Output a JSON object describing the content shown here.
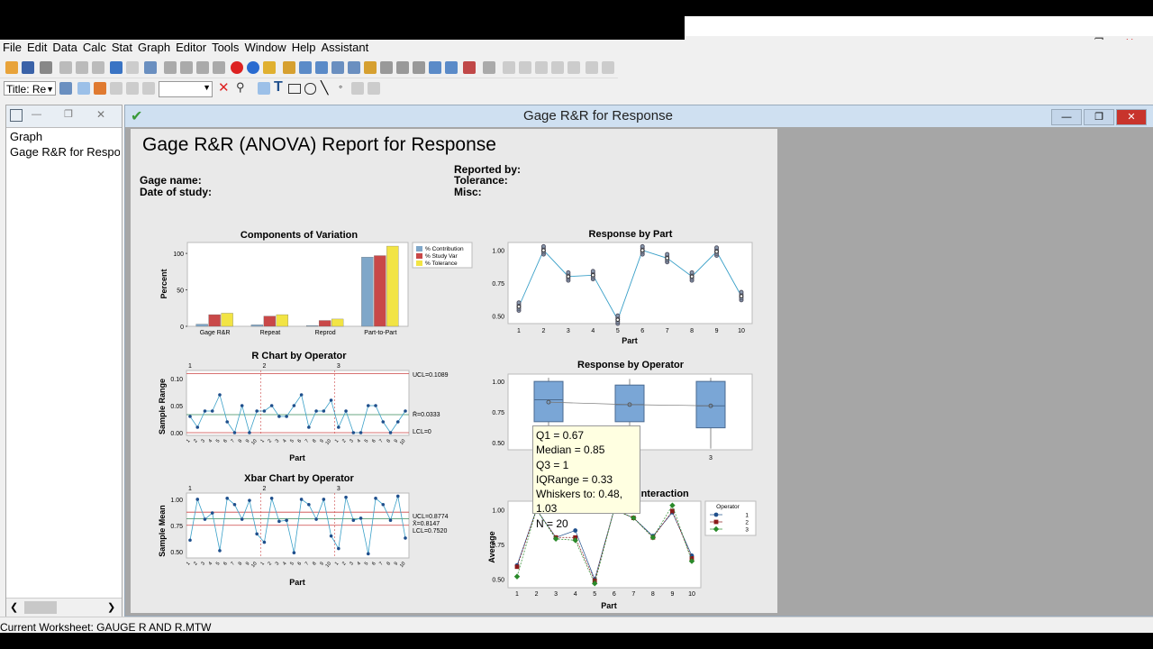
{
  "menu": [
    "File",
    "Edit",
    "Data",
    "Calc",
    "Stat",
    "Graph",
    "Editor",
    "Tools",
    "Window",
    "Help",
    "Assistant"
  ],
  "toolbar2": {
    "title_dropdown": "Title: Re"
  },
  "left_panel": {
    "items": [
      "Graph",
      "Gage R&R for Respon"
    ]
  },
  "doc_window": {
    "title": "Gage R&R for Response"
  },
  "report": {
    "title": "Gage R&R (ANOVA) Report for Response",
    "gage_name": "Gage name:",
    "date_of_study": "Date of study:",
    "reported_by": "Reported by:",
    "tolerance": "Tolerance:",
    "misc": "Misc:"
  },
  "tooltip": [
    "Q1 = 0.67",
    "Median = 0.85",
    "Q3 = 1",
    "IQRange = 0.33",
    "Whiskers to: 0.48, 1.03",
    "N = 20"
  ],
  "status": "Current Worksheet: GAUGE R AND R.MTW",
  "colors": {
    "contribution": "#7fa7c9",
    "studyvar": "#c94848",
    "tolerance": "#f2e444",
    "line": "#3aa0c8",
    "point": "#1f4f8c",
    "box": "#7aa6d6"
  },
  "chart_data": [
    {
      "type": "bar",
      "title": "Components of Variation",
      "ylabel": "Percent",
      "categories": [
        "Gage R&R",
        "Repeat",
        "Reprod",
        "Part-to-Part"
      ],
      "series": [
        {
          "name": "% Contribution",
          "values": [
            3,
            2,
            1,
            95
          ]
        },
        {
          "name": "% Study Var",
          "values": [
            16,
            14,
            8,
            97
          ]
        },
        {
          "name": "% Tolerance",
          "values": [
            18,
            16,
            10,
            110
          ]
        }
      ],
      "yticks": [
        0,
        50,
        100
      ],
      "ylim": [
        0,
        115
      ]
    },
    {
      "type": "scatter",
      "title": "Response by Part",
      "xlabel": "Part",
      "x": [
        1,
        2,
        3,
        4,
        5,
        6,
        7,
        8,
        9,
        10
      ],
      "means": [
        0.57,
        1.0,
        0.8,
        0.81,
        0.47,
        1.0,
        0.94,
        0.8,
        0.99,
        0.65
      ],
      "yticks": [
        0.5,
        0.75,
        1.0
      ],
      "ylim": [
        0.44,
        1.06
      ]
    },
    {
      "type": "line",
      "title": "R Chart by Operator",
      "xlabel": "Part",
      "ylabel": "Sample Range",
      "operators": [
        "1",
        "2",
        "3"
      ],
      "values": [
        0.03,
        0.01,
        0.04,
        0.04,
        0.07,
        0.02,
        0.0,
        0.05,
        0.0,
        0.04,
        0.04,
        0.05,
        0.03,
        0.03,
        0.05,
        0.07,
        0.01,
        0.04,
        0.04,
        0.06,
        0.01,
        0.04,
        0.0,
        0.0,
        0.05,
        0.05,
        0.02,
        0.0,
        0.02,
        0.04
      ],
      "ucl": "UCL=0.1089",
      "rbar": "R̄=0.0333",
      "lcl": "LCL=0",
      "yticks": [
        0.0,
        0.05,
        0.1
      ],
      "ylim": [
        -0.005,
        0.115
      ]
    },
    {
      "type": "line",
      "title": "Xbar Chart by Operator",
      "xlabel": "Part",
      "ylabel": "Sample Mean",
      "operators": [
        "1",
        "2",
        "3"
      ],
      "values": [
        0.61,
        1.0,
        0.81,
        0.87,
        0.51,
        1.01,
        0.95,
        0.81,
        0.99,
        0.67,
        0.59,
        1.01,
        0.79,
        0.8,
        0.49,
        1.0,
        0.95,
        0.81,
        1.0,
        0.65,
        0.53,
        1.02,
        0.8,
        0.82,
        0.48,
        1.01,
        0.95,
        0.8,
        1.03,
        0.63
      ],
      "ucl": "UCL=0.8774",
      "xbar": "X̄=0.8147",
      "lcl": "LCL=0.7520",
      "yticks": [
        0.5,
        0.75,
        1.0
      ],
      "ylim": [
        0.44,
        1.06
      ]
    },
    {
      "type": "box",
      "title": "Response by Operator",
      "operators": [
        "1",
        "2",
        "3"
      ],
      "boxes": [
        {
          "q1": 0.67,
          "median": 0.85,
          "q3": 1.0,
          "lo": 0.48,
          "hi": 1.03,
          "mean": 0.83
        },
        {
          "q1": 0.67,
          "median": 0.81,
          "q3": 0.97,
          "lo": 0.47,
          "hi": 1.02,
          "mean": 0.81
        },
        {
          "q1": 0.62,
          "median": 0.8,
          "q3": 1.0,
          "lo": 0.45,
          "hi": 1.03,
          "mean": 0.8
        }
      ],
      "yticks": [
        0.5,
        0.75,
        1.0
      ],
      "ylim": [
        0.44,
        1.06
      ]
    },
    {
      "type": "line",
      "title": "Part * Operator Interaction",
      "xlabel": "Part",
      "ylabel": "Average",
      "legend_title": "Operator",
      "x": [
        1,
        2,
        3,
        4,
        5,
        6,
        7,
        8,
        9,
        10
      ],
      "series": [
        {
          "name": "1",
          "values": [
            0.6,
            1.0,
            0.8,
            0.85,
            0.5,
            1.0,
            0.94,
            0.81,
            0.98,
            0.67
          ]
        },
        {
          "name": "2",
          "values": [
            0.59,
            1.0,
            0.8,
            0.8,
            0.49,
            1.0,
            0.94,
            0.8,
            0.99,
            0.65
          ]
        },
        {
          "name": "3",
          "values": [
            0.52,
            1.0,
            0.79,
            0.78,
            0.47,
            1.0,
            0.94,
            0.8,
            1.03,
            0.63
          ]
        }
      ],
      "yticks": [
        0.5,
        0.75,
        1.0
      ],
      "ylim": [
        0.44,
        1.06
      ]
    }
  ]
}
